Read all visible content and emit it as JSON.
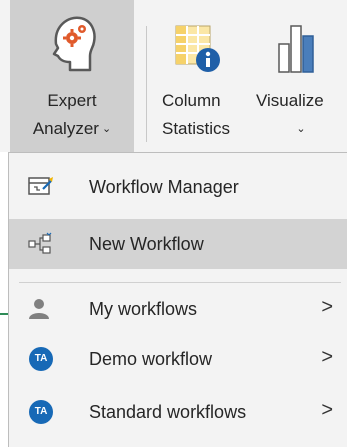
{
  "ribbon": {
    "expert_analyzer": {
      "line1": "Expert",
      "line2": "Analyzer",
      "caret": "⌄"
    },
    "column_statistics": {
      "line1": "Column",
      "line2": "Statistics"
    },
    "visualize": {
      "line1": "Visualize",
      "caret": "⌄"
    }
  },
  "menu": {
    "items": [
      {
        "label": "Workflow Manager",
        "icon": "workflow-manager-icon"
      },
      {
        "label": "New Workflow",
        "icon": "new-workflow-icon"
      },
      {
        "label": "My workflows",
        "icon": "user-icon",
        "chevron": ">"
      },
      {
        "label": "Demo workflow",
        "icon": "ta-badge-icon",
        "badge": "TA",
        "chevron": ">"
      },
      {
        "label": "Standard workflows",
        "icon": "ta-badge-icon",
        "badge": "TA",
        "chevron": ">"
      }
    ]
  },
  "colors": {
    "highlight": "#d3d3d3",
    "badge": "#1769b6",
    "chart_blue": "#4a7ebb"
  }
}
